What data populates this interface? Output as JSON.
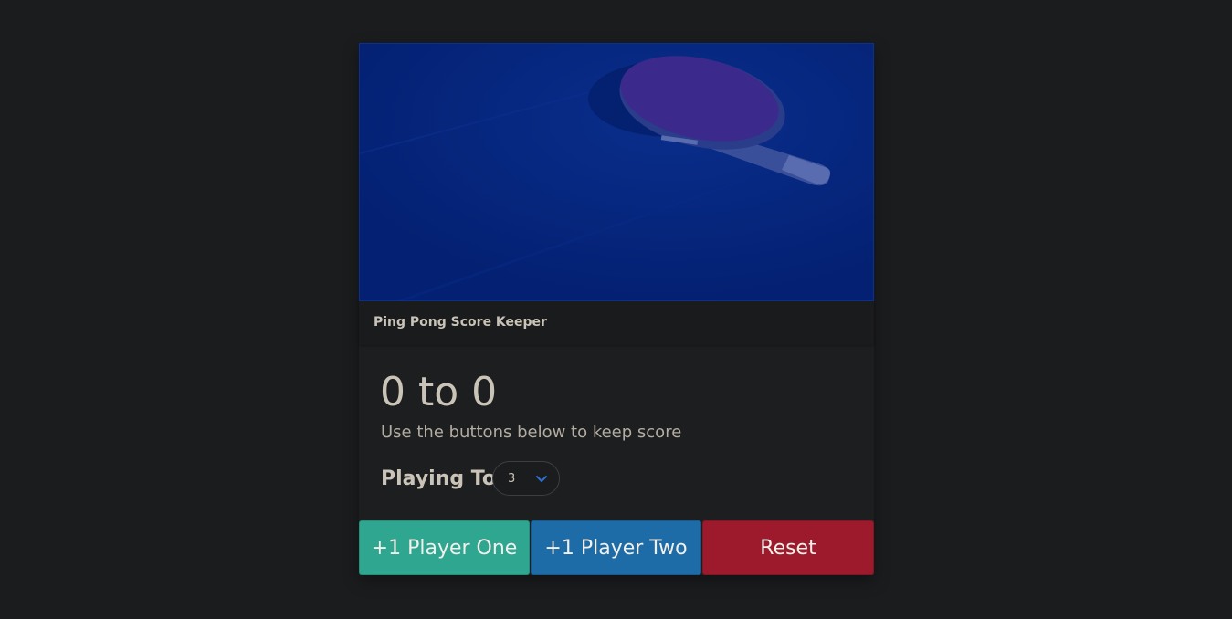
{
  "card": {
    "header_title": "Ping Pong Score Keeper"
  },
  "hero": {
    "image_icon": "ping-pong-paddle-icon",
    "tint_color": "#042680"
  },
  "score": {
    "display": "0 to 0",
    "subtitle": "Use the buttons below to keep score"
  },
  "playing_to": {
    "label": "Playing To",
    "selected_value": "3",
    "chevron_icon": "chevron-down-icon"
  },
  "buttons": {
    "player_one": "+1 Player One",
    "player_two": "+1 Player Two",
    "reset": "Reset"
  },
  "colors": {
    "player_one": "#2fa690",
    "player_two": "#1d6ba7",
    "reset": "#9c1a2b",
    "background": "#1b1c1e"
  }
}
